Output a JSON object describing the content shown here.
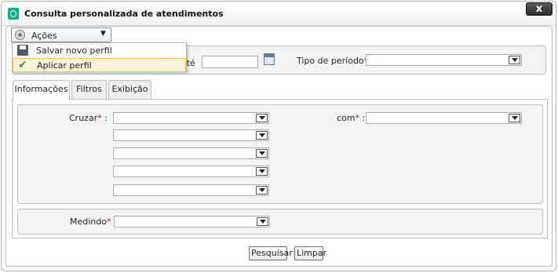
{
  "window": {
    "title": "Consulta personalizada de atendimentos",
    "close_label": "x"
  },
  "actions": {
    "label": "Ações",
    "menu": [
      {
        "label": "Salvar novo perfil",
        "icon": "floppy-disk-icon"
      },
      {
        "label": "Aplicar perfil",
        "icon": "checkmark-icon"
      }
    ]
  },
  "period": {
    "ate_label": "até",
    "ate_value": "",
    "tipo_label": "Tipo de período",
    "tipo_value": ""
  },
  "tabs": [
    {
      "label": "Informações",
      "active": true
    },
    {
      "label": "Filtros",
      "active": false
    },
    {
      "label": "Exibição",
      "active": false
    }
  ],
  "info": {
    "cruzar_label": "Cruzar",
    "com_label": "com",
    "medindo_label": "Medindo",
    "required_mark": "*",
    "colon": ":"
  },
  "buttons": {
    "search": "Pesquisar",
    "clear": "Limpar"
  },
  "colors": {
    "accent": "#1aa88a",
    "required": "#d01010",
    "menu_hover": "#fdf2d8"
  }
}
